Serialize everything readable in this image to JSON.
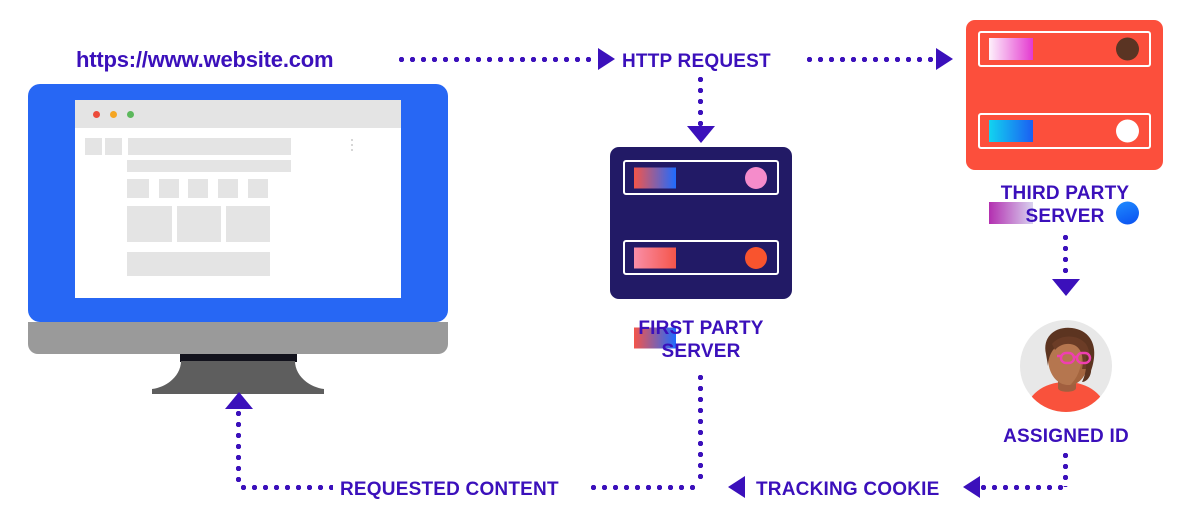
{
  "diagram": {
    "title_url": "https://www.website.com",
    "accent_color": "#3b10bb",
    "monitor_color": "#2767f4",
    "first_server_color": "#221a66",
    "third_server_color": "#fc4f3c"
  },
  "nodes": {
    "browser": {
      "url": "https://www.website.com",
      "traffic_lights": [
        "#ec4b3a",
        "#f5a623",
        "#5cb85c"
      ]
    },
    "first_party_server": {
      "label": "FIRST PARTY\nSERVER",
      "bays": [
        {
          "chip_from": "#f4554a",
          "chip_to": "#1f6bff",
          "led": "#f58ccb"
        },
        {
          "chip_from": "#fa8fa8",
          "chip_to": "#f4554a",
          "led": "#f9542e"
        },
        {
          "chip_from": "#f4554a",
          "chip_to": "#1f6bff",
          "led": "#ffffff"
        }
      ]
    },
    "third_party_server": {
      "label": "THIRD PARTY\nSERVER",
      "bays": [
        {
          "chip_from": "#fdf0fb",
          "chip_to": "#e43ad0",
          "led": "#5a3423"
        },
        {
          "chip_from": "#12d4f0",
          "chip_to": "#1b5ef2",
          "led": "#ffffff"
        },
        {
          "chip_from": "#b32fb0",
          "chip_to": "#d8d2ef",
          "led_from": "#1f8cff",
          "led_to": "#0a4ff0"
        }
      ]
    },
    "assigned_id": {
      "label": "ASSIGNED ID"
    }
  },
  "flows": [
    {
      "id": "http-request",
      "label": "HTTP REQUEST"
    },
    {
      "id": "requested-content",
      "label": "REQUESTED CONTENT"
    },
    {
      "id": "tracking-cookie",
      "label": "TRACKING COOKIE"
    }
  ]
}
